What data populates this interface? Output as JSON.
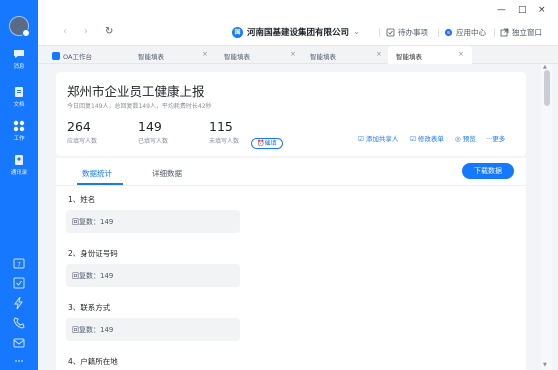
{
  "rail": {
    "items": [
      {
        "label": "消息",
        "icon": "chat-icon"
      },
      {
        "label": "文档",
        "icon": "document-icon"
      },
      {
        "label": "工作",
        "icon": "apps-grid-icon"
      },
      {
        "label": "通讯录",
        "icon": "contacts-icon"
      }
    ],
    "tools": [
      "calendar-icon",
      "checklist-icon",
      "flash-icon",
      "phone-icon",
      "mail-icon",
      "more-icon"
    ]
  },
  "window": {
    "minimize": "—",
    "maximize": "□",
    "close": "×"
  },
  "nav": {
    "back": "‹",
    "forward": "›",
    "refresh": "↻"
  },
  "header": {
    "company": "河南国基建设集团有限公司",
    "company_caret": "⌄",
    "todo": "待办事项",
    "app_center": "应用中心",
    "standalone": "独立窗口"
  },
  "tabs": [
    {
      "label": "OA工作台"
    },
    {
      "label": "智能填表"
    },
    {
      "label": "智能填表"
    },
    {
      "label": "智能填表"
    },
    {
      "label": "智能填表"
    }
  ],
  "form": {
    "title": "郑州市企业员工健康上报",
    "subtitle": "今日回复149人，总回复数149人，平均耗费时长42秒",
    "stats": [
      {
        "value": "264",
        "label": "应填写人数"
      },
      {
        "value": "149",
        "label": "已填写人数"
      },
      {
        "value": "115",
        "label": "未填写人数"
      }
    ],
    "remind": "催填",
    "actions": {
      "add_collaborator": "添加共享人",
      "edit_form": "修改表单",
      "preview": "预览",
      "more": "更多"
    }
  },
  "panel": {
    "tab_stats": "数据统计",
    "tab_detail": "详细数据",
    "download": "下载数据",
    "questions": [
      {
        "label": "1、姓名",
        "answer": "回复数：149"
      },
      {
        "label": "2、身份证号码",
        "answer": "回复数：149"
      },
      {
        "label": "3、联系方式",
        "answer": "回复数：149"
      },
      {
        "label": "4、户籍所在地",
        "answer": ""
      }
    ]
  },
  "colors": {
    "accent": "#1677ff",
    "rail": "#1677ff",
    "background": "#f2f4f7"
  }
}
